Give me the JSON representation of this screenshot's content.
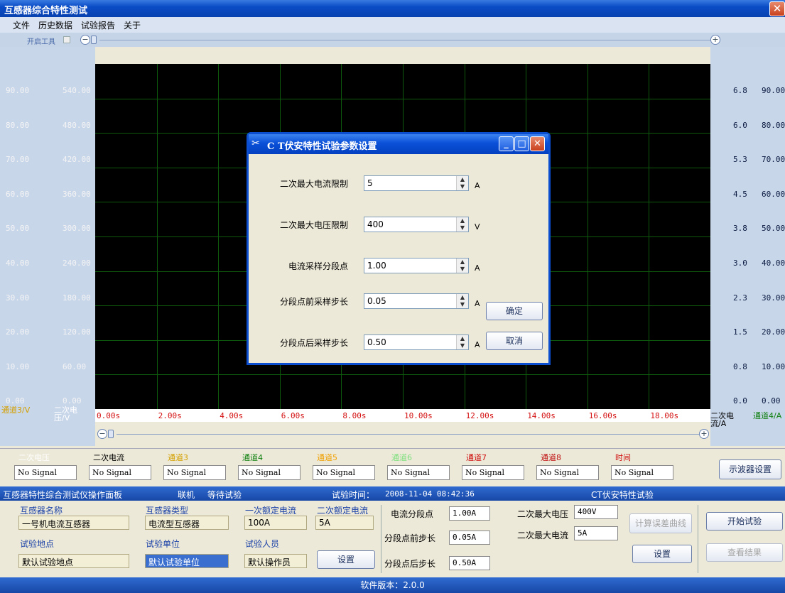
{
  "window": {
    "title": "互感器综合特性测试",
    "close_label": "✕"
  },
  "menu": [
    "文件",
    "历史数据",
    "试验报告",
    "关于"
  ],
  "toolstrip": {
    "label": "开启工具"
  },
  "axes": {
    "left1_ticks": [
      "90.00",
      "80.00",
      "70.00",
      "60.00",
      "50.00",
      "40.00",
      "30.00",
      "20.00",
      "10.00",
      "0.00"
    ],
    "left2_ticks": [
      "540.00",
      "480.00",
      "420.00",
      "360.00",
      "300.00",
      "240.00",
      "180.00",
      "120.00",
      "60.00",
      "0.00"
    ],
    "right1_ticks": [
      "6.8",
      "6.0",
      "5.3",
      "4.5",
      "3.8",
      "3.0",
      "2.3",
      "1.5",
      "0.8",
      "0.0"
    ],
    "right2_ticks": [
      "90.00",
      "80.00",
      "70.00",
      "60.00",
      "50.00",
      "40.00",
      "30.00",
      "20.00",
      "10.00",
      "0.00"
    ],
    "left1_label": "通道3/V",
    "left2_label": "二次电压/V",
    "right1_label": "二次电流/A",
    "right2_label": "通道4/A",
    "x_ticks": [
      "0.00s",
      "2.00s",
      "4.00s",
      "6.00s",
      "8.00s",
      "10.00s",
      "12.00s",
      "14.00s",
      "16.00s",
      "18.00s"
    ]
  },
  "channels": [
    {
      "label": "二次电压",
      "color": "#ffffff",
      "value": "No Signal"
    },
    {
      "label": "二次电流",
      "color": "#000000",
      "value": "No Signal"
    },
    {
      "label": "通道3",
      "color": "#d4a000",
      "value": "No Signal"
    },
    {
      "label": "通道4",
      "color": "#108010",
      "value": "No Signal"
    },
    {
      "label": "通道5",
      "color": "#f0a000",
      "value": "No Signal"
    },
    {
      "label": "通道6",
      "color": "#7ee07e",
      "value": "No Signal"
    },
    {
      "label": "通道7",
      "color": "#d01010",
      "value": "No Signal"
    },
    {
      "label": "通道8",
      "color": "#c01010",
      "value": "No Signal"
    },
    {
      "label": "时间",
      "color": "#d01010",
      "value": "No Signal"
    }
  ],
  "scope_settings_label": "示波器设置",
  "status": {
    "panel_name": "互感器特性综合测试仪操作面板",
    "connection": "联机",
    "state": "等待试验",
    "time_label": "试验时间：",
    "time_value": "2008-11-04 08:42:36",
    "test_name": "CT伏安特性试验"
  },
  "info": {
    "name_label": "互感器名称",
    "name_value": "一号机电流互感器",
    "type_label": "互感器类型",
    "type_value": "电流型互感器",
    "primary_label": "一次额定电流",
    "primary_value": "100A",
    "secondary_label": "二次额定电流",
    "secondary_value": "5A",
    "location_label": "试验地点",
    "location_value": "默认试验地点",
    "unit_label": "试验单位",
    "unit_value": "默认试验单位",
    "operator_label": "试验人员",
    "operator_value": "默认操作员",
    "settings_label": "设置"
  },
  "params": {
    "seg_label": "电流分段点",
    "seg_value": "1.00A",
    "pre_label": "分段点前步长",
    "pre_value": "0.05A",
    "post_label": "分段点后步长",
    "post_value": "0.50A",
    "maxv_label": "二次最大电压",
    "maxv_value": "400V",
    "maxi_label": "二次最大电流",
    "maxi_value": "5A",
    "calc_label": "计算误差曲线",
    "settings_label": "设置"
  },
  "actions": {
    "start_label": "开始试验",
    "result_label": "查看结果"
  },
  "footer": "软件版本：2.0.0",
  "dialog": {
    "title": "C T伏安特性试验参数设置",
    "fields": [
      {
        "label": "二次最大电流限制",
        "value": "5",
        "unit": "A"
      },
      {
        "label": "二次最大电压限制",
        "value": "400",
        "unit": "V"
      },
      {
        "label": "电流采样分段点",
        "value": "1.00",
        "unit": "A"
      },
      {
        "label": "分段点前采样步长",
        "value": "0.05",
        "unit": "A"
      },
      {
        "label": "分段点后采样步长",
        "value": "0.50",
        "unit": "A"
      }
    ],
    "ok_label": "确定",
    "cancel_label": "取消"
  }
}
